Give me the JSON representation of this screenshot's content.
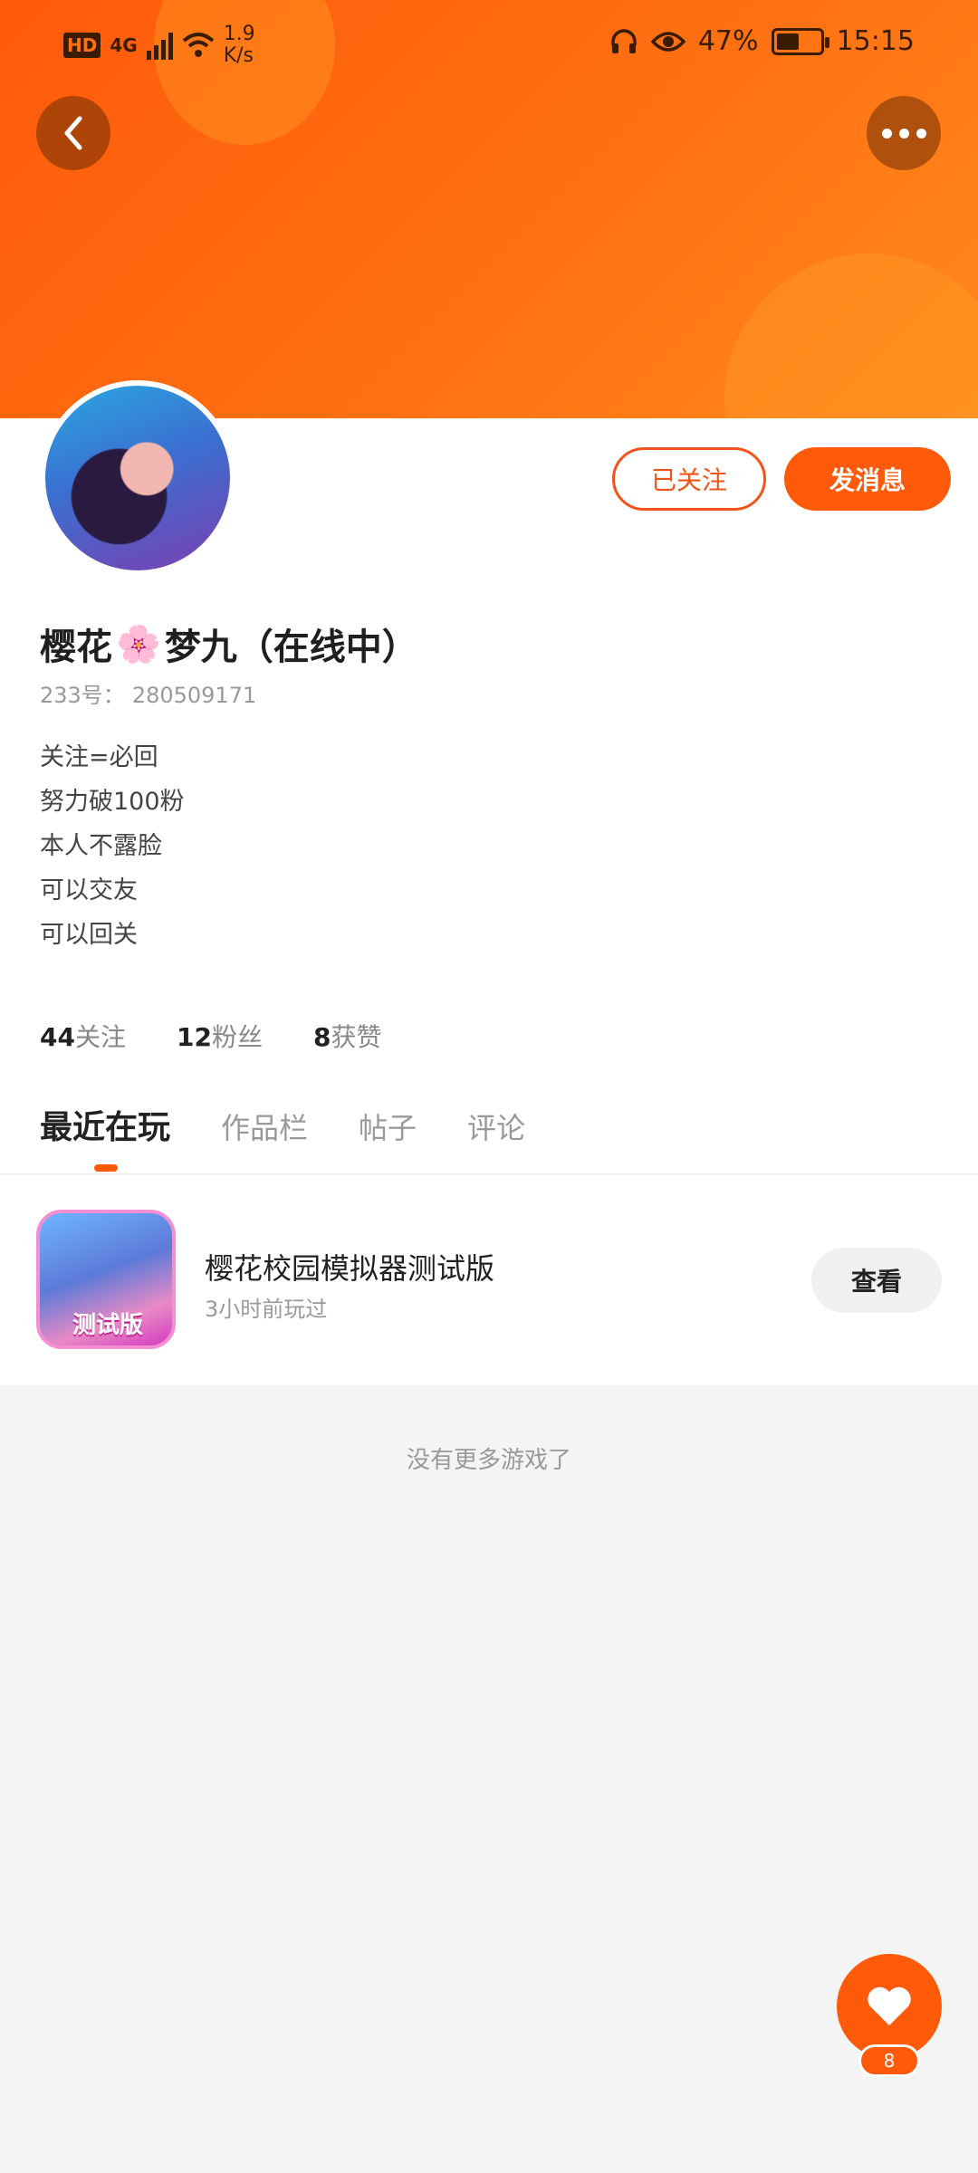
{
  "status_bar": {
    "hd": "HD",
    "network": "4G",
    "speed_value": "1.9",
    "speed_unit": "K/s",
    "battery_percent": "47%",
    "time": "15:15"
  },
  "header": {
    "back_icon": "chevron-left-icon",
    "more_icon": "more-dots-icon"
  },
  "actions": {
    "followed_label": "已关注",
    "message_label": "发消息"
  },
  "profile": {
    "name_part1": "樱花",
    "name_emoji": "🌸",
    "name_part2": "梦九（在线中）",
    "id_label": "233号：",
    "id_value": "280509171",
    "bio": [
      "关注=必回",
      "努力破100粉",
      "本人不露脸",
      "可以交友",
      "可以回关"
    ]
  },
  "stats": {
    "following_count": "44",
    "following_label": "关注",
    "fans_count": "12",
    "fans_label": "粉丝",
    "likes_count": "8",
    "likes_label": "获赞"
  },
  "tabs": [
    "最近在玩",
    "作品栏",
    "帖子",
    "评论"
  ],
  "game": {
    "icon_tag": "测试版",
    "title": "樱花校园模拟器测试版",
    "subtitle": "3小时前玩过",
    "view_label": "查看"
  },
  "footer_text": "没有更多游戏了",
  "like_fab": {
    "icon": "heart-icon",
    "count": "8"
  },
  "colors": {
    "accent": "#ff5a0a",
    "banner": "#ff7012"
  }
}
